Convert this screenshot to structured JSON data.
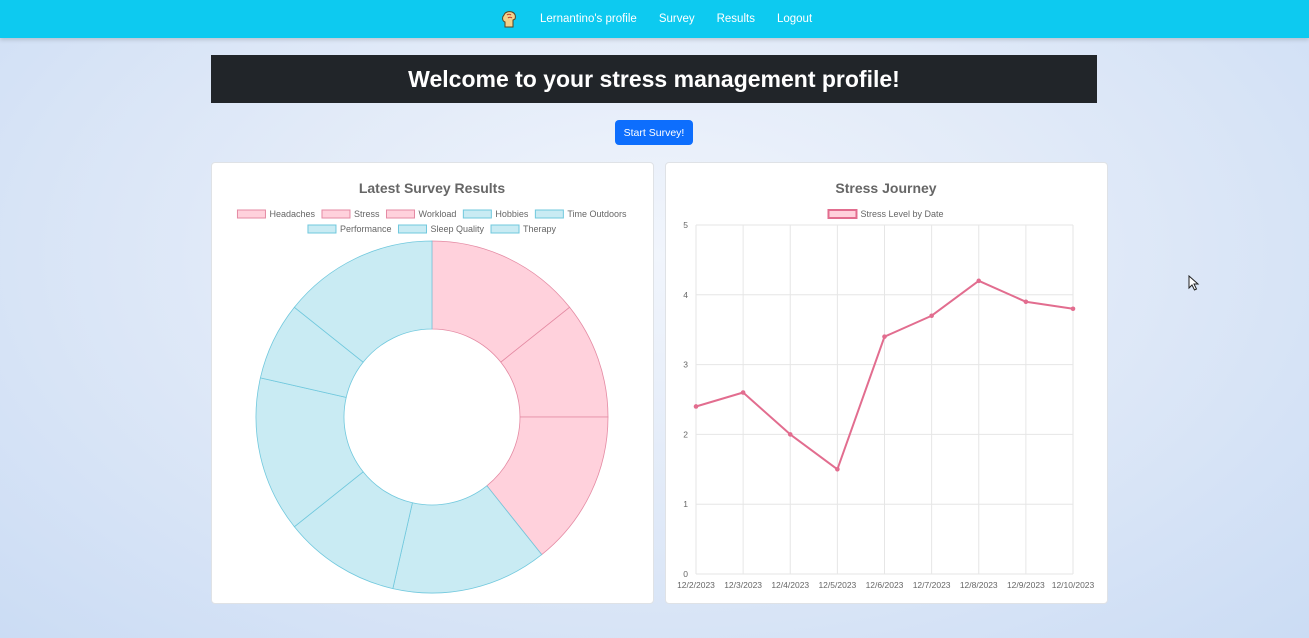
{
  "nav": {
    "logo_icon": "brain-fist-icon",
    "links": [
      "Lernantino's profile",
      "Survey",
      "Results",
      "Logout"
    ]
  },
  "banner": {
    "title": "Welcome to your stress management profile!"
  },
  "start_button": {
    "label": "Start Survey!"
  },
  "colors": {
    "navbar": "#0dcaf0",
    "banner": "#212529",
    "button": "#0d6efd",
    "stress_fill": "#ffd1dc",
    "stress_border": "#e48aa3",
    "positive_fill": "#c9ebf3",
    "positive_border": "#70c8dd",
    "line": "#e26d8f"
  },
  "chart_data": [
    {
      "type": "doughnut",
      "title": "Latest Survey Results",
      "categories": [
        "Headaches",
        "Stress",
        "Workload",
        "Hobbies",
        "Time Outdoors",
        "Performance",
        "Sleep Quality",
        "Therapy"
      ],
      "values": [
        4,
        3,
        4,
        4,
        3,
        4,
        2,
        4
      ],
      "category_groups": [
        "stress",
        "stress",
        "stress",
        "positive",
        "positive",
        "positive",
        "positive",
        "positive"
      ],
      "legend": "top"
    },
    {
      "type": "line",
      "title": "Stress Journey",
      "series": [
        {
          "name": "Stress Level by Date",
          "values": [
            2.4,
            2.6,
            2.0,
            1.5,
            3.4,
            3.7,
            4.2,
            3.9,
            3.8
          ]
        }
      ],
      "x": [
        "12/2/2023",
        "12/3/2023",
        "12/4/2023",
        "12/5/2023",
        "12/6/2023",
        "12/7/2023",
        "12/8/2023",
        "12/9/2023",
        "12/10/2023"
      ],
      "ylim": [
        0,
        5
      ],
      "yticks": [
        "0",
        "1",
        "2",
        "3",
        "4",
        "5"
      ],
      "grid": true,
      "legend": "top"
    }
  ]
}
